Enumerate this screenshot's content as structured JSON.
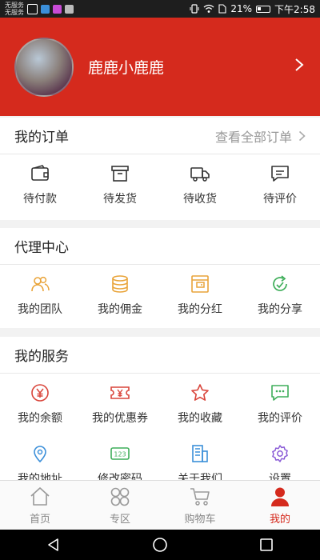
{
  "status_bar": {
    "carrier_line1": "无服务",
    "carrier_line2": "无服务",
    "battery": "21%",
    "time": "下午2:58"
  },
  "profile": {
    "username": "鹿鹿小鹿鹿"
  },
  "orders": {
    "title": "我的订单",
    "view_all": "查看全部订单",
    "items": [
      {
        "label": "待付款",
        "icon": "wallet-icon"
      },
      {
        "label": "待发货",
        "icon": "box-icon"
      },
      {
        "label": "待收货",
        "icon": "truck-icon"
      },
      {
        "label": "待评价",
        "icon": "comment-icon"
      }
    ]
  },
  "agent": {
    "title": "代理中心",
    "items": [
      {
        "label": "我的团队",
        "icon": "team-icon"
      },
      {
        "label": "我的佣金",
        "icon": "coins-icon"
      },
      {
        "label": "我的分红",
        "icon": "dividend-icon"
      },
      {
        "label": "我的分享",
        "icon": "share-icon"
      }
    ]
  },
  "services": {
    "title": "我的服务",
    "items": [
      {
        "label": "我的余额",
        "icon": "yen-icon"
      },
      {
        "label": "我的优惠券",
        "icon": "coupon-icon"
      },
      {
        "label": "我的收藏",
        "icon": "star-icon"
      },
      {
        "label": "我的评价",
        "icon": "review-icon"
      },
      {
        "label": "我的地址",
        "icon": "location-icon"
      },
      {
        "label": "修改密码",
        "icon": "password-icon"
      },
      {
        "label": "关于我们",
        "icon": "about-icon"
      },
      {
        "label": "设置",
        "icon": "settings-icon"
      }
    ]
  },
  "tabbar": {
    "items": [
      {
        "label": "首页",
        "icon": "home-icon"
      },
      {
        "label": "专区",
        "icon": "zone-icon"
      },
      {
        "label": "购物车",
        "icon": "cart-icon"
      },
      {
        "label": "我的",
        "icon": "user-icon"
      }
    ],
    "active_index": 3
  },
  "colors": {
    "brand_red": "#d52a1d",
    "agent_orange": "#e9a43a",
    "service_red": "#d9453b",
    "service_green": "#3fae5a",
    "service_blue": "#3b8fd9",
    "service_purple": "#8a5bd6"
  }
}
